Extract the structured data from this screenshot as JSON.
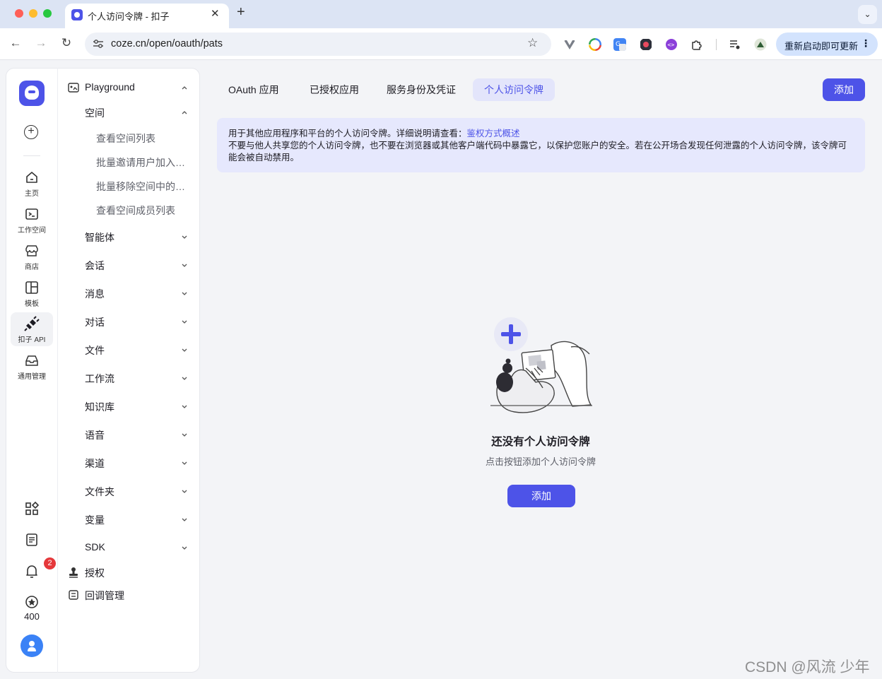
{
  "browser": {
    "tab_title": "个人访问令牌 - 扣子",
    "url": "coze.cn/open/oauth/pats",
    "update_button": "重新启动即可更新"
  },
  "rail": {
    "items": [
      {
        "label": "主页"
      },
      {
        "label": "工作空间"
      },
      {
        "label": "商店"
      },
      {
        "label": "模板"
      },
      {
        "label": "扣子 API"
      },
      {
        "label": "通用管理"
      }
    ],
    "notification_count": "2",
    "credits": "400"
  },
  "doc_nav": {
    "playground": "Playground",
    "space": "空间",
    "space_children": [
      "查看空间列表",
      "批量邀请用户加入…",
      "批量移除空间中的…",
      "查看空间成员列表"
    ],
    "sections": [
      "智能体",
      "会话",
      "消息",
      "对话",
      "文件",
      "工作流",
      "知识库",
      "语音",
      "渠道",
      "文件夹",
      "变量",
      "SDK"
    ],
    "auth": "授权",
    "callback": "回调管理"
  },
  "main": {
    "tabs": [
      "OAuth 应用",
      "已授权应用",
      "服务身份及凭证",
      "个人访问令牌"
    ],
    "active_tab": "个人访问令牌",
    "add_button": "添加",
    "notice_line1": "用于其他应用程序和平台的个人访问令牌。详细说明请查看：",
    "notice_link": "鉴权方式概述",
    "notice_line2": "不要与他人共享您的个人访问令牌，也不要在浏览器或其他客户端代码中暴露它，以保护您账户的安全。若在公开场合发现任何泄露的个人访问令牌，该令牌可能会被自动禁用。",
    "empty_title": "还没有个人访问令牌",
    "empty_desc": "点击按钮添加个人访问令牌",
    "empty_add_button": "添加"
  },
  "watermark": "CSDN @风流 少年",
  "colors": {
    "accent": "#4d53e8",
    "notice_bg": "#e6e8fd",
    "badge": "#e5383b"
  }
}
